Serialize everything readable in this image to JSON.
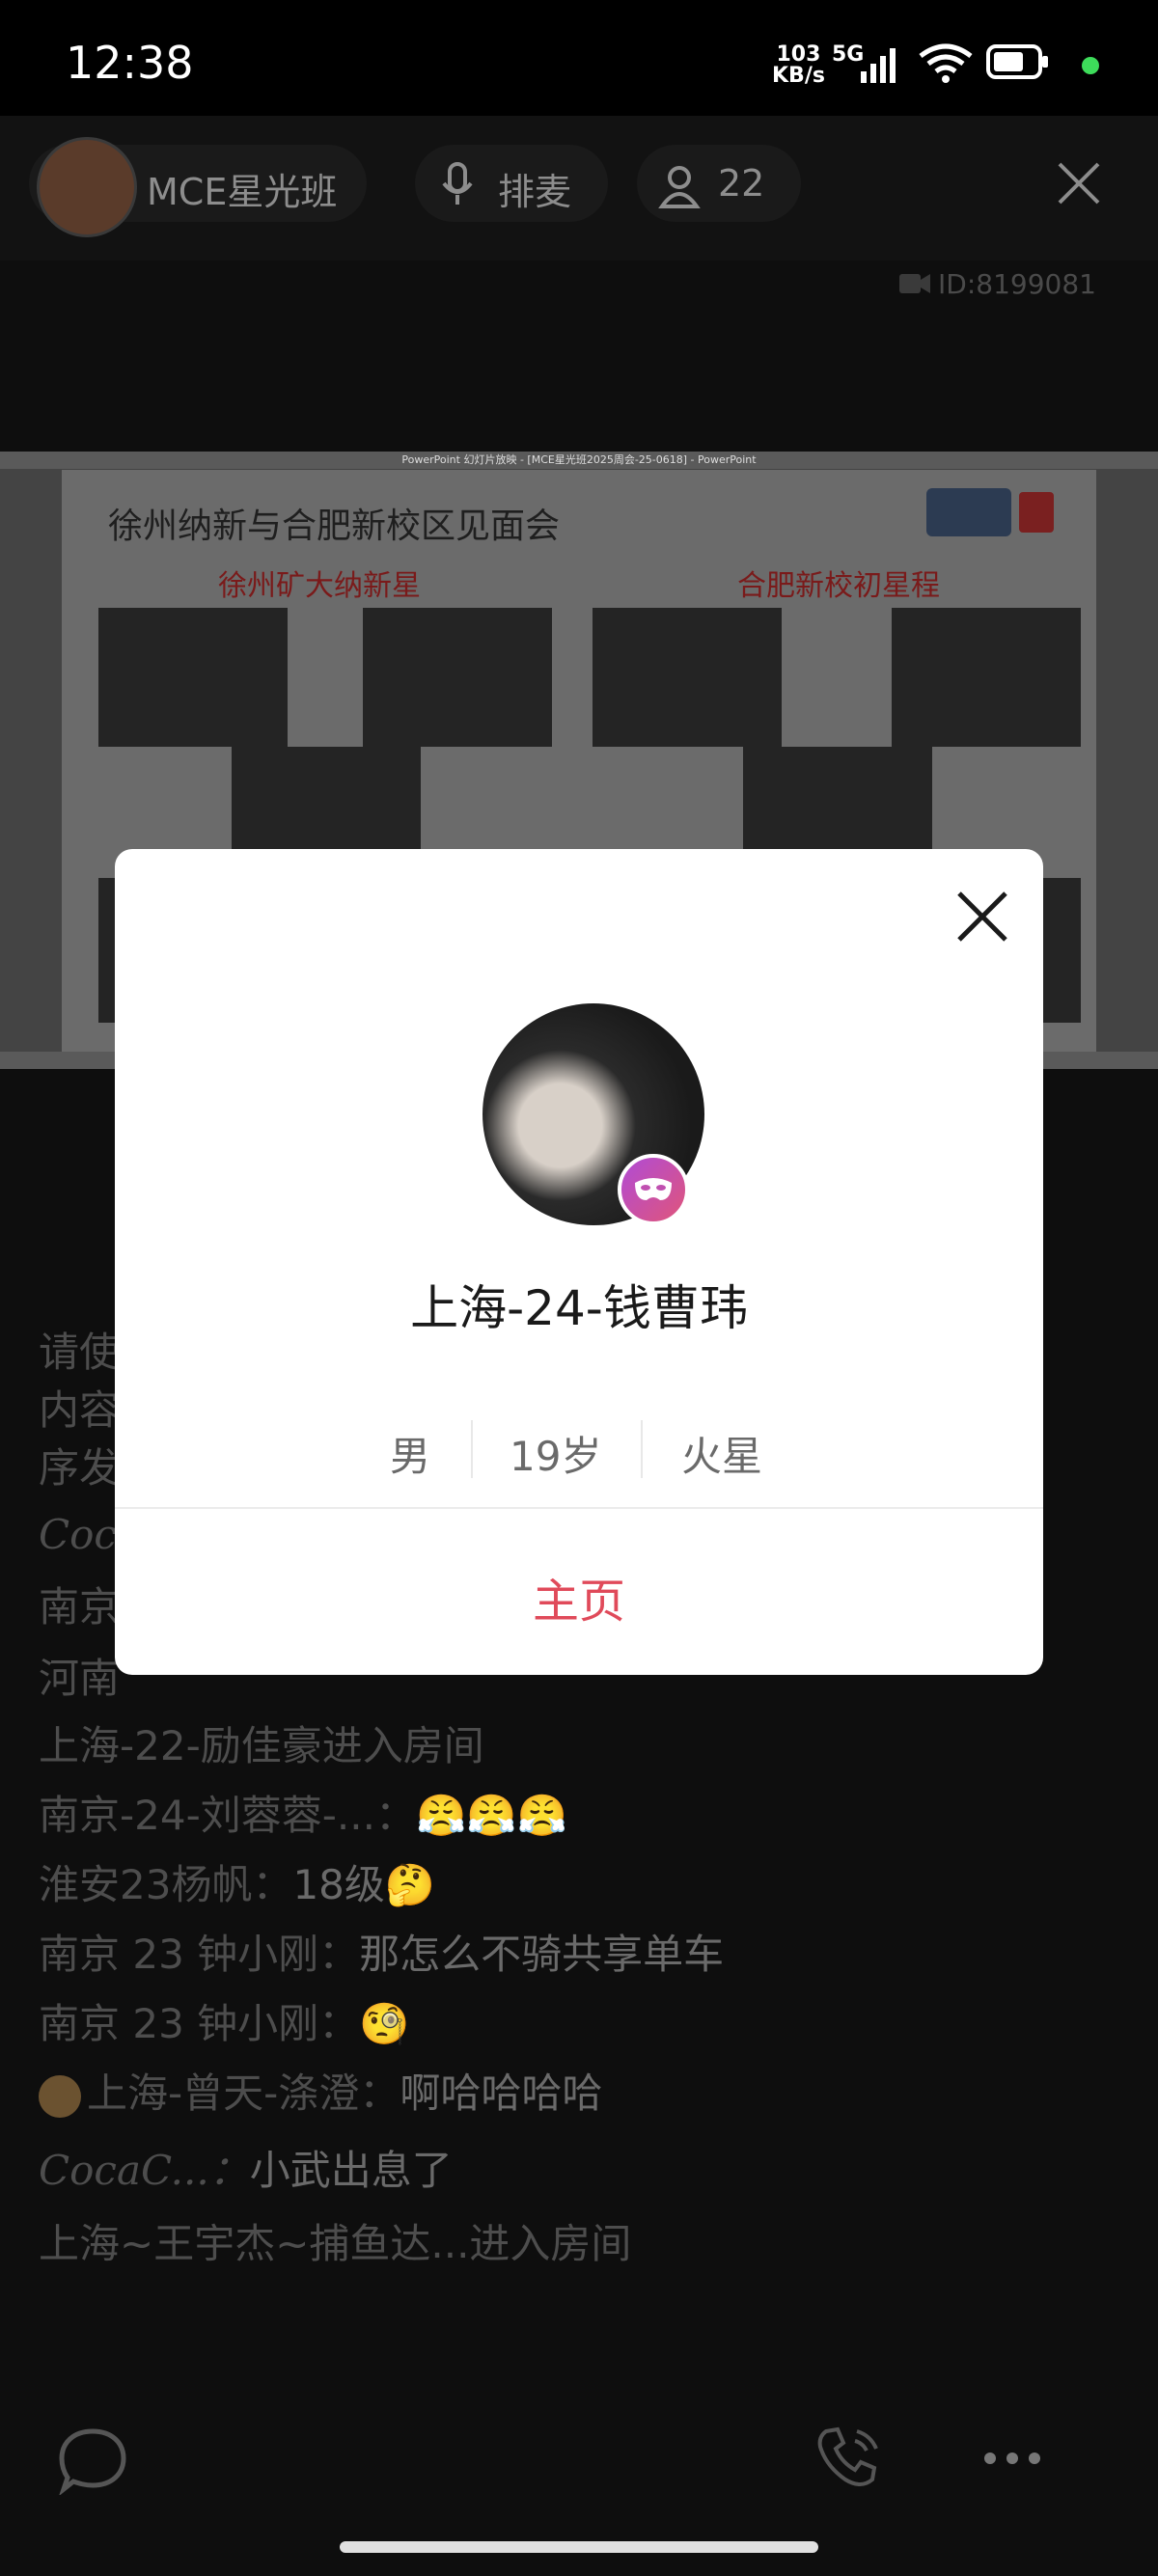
{
  "status_bar": {
    "time": "12:38",
    "net_speed_value": "103",
    "net_speed_unit": "KB/s",
    "net_type": "5G",
    "battery_dot_color": "#3ddc5a"
  },
  "header": {
    "room_name": "MCE星光班",
    "mic_label": "排麦",
    "user_count": "22",
    "room_id": "ID:8199081"
  },
  "slide": {
    "window_title": "PowerPoint 幻灯片放映 - [MCE星光班2025周会-25-0618] - PowerPoint",
    "heading": "徐州纳新与合肥新校区见面会",
    "sub_left": "徐州矿大纳新星",
    "sub_right": "合肥新校初星程"
  },
  "chat": {
    "partial_lines": [
      "请使",
      "内容",
      "序发",
      "Coca",
      "南京",
      "河南"
    ],
    "messages": [
      {
        "name": "上海-22-励佳豪进入房间",
        "msg": ""
      },
      {
        "name": "南京-24-刘蓉蓉-...：",
        "msg": "😤😤😤"
      },
      {
        "name": "淮安23杨帆：",
        "msg": "18级🤔"
      },
      {
        "name": "南京 23 钟小刚：",
        "msg": "那怎么不骑共享单车"
      },
      {
        "name": "南京 23 钟小刚：",
        "msg": "🧐"
      },
      {
        "name": "上海-曾天-涤澄：",
        "msg": "啊哈哈哈哈"
      },
      {
        "name": "CocaC...：",
        "msg": "小武出息了"
      },
      {
        "name": "上海~王宇杰~捕鱼达...进入房间",
        "msg": ""
      }
    ]
  },
  "modal": {
    "user_name": "上海-24-钱曹玮",
    "gender": "男",
    "age": "19岁",
    "zodiac": "火星",
    "profile_link": "主页"
  },
  "colors": {
    "accent_red": "#e04a5a",
    "badge_gradient_start": "#b04bd6",
    "badge_gradient_end": "#e0557a"
  }
}
